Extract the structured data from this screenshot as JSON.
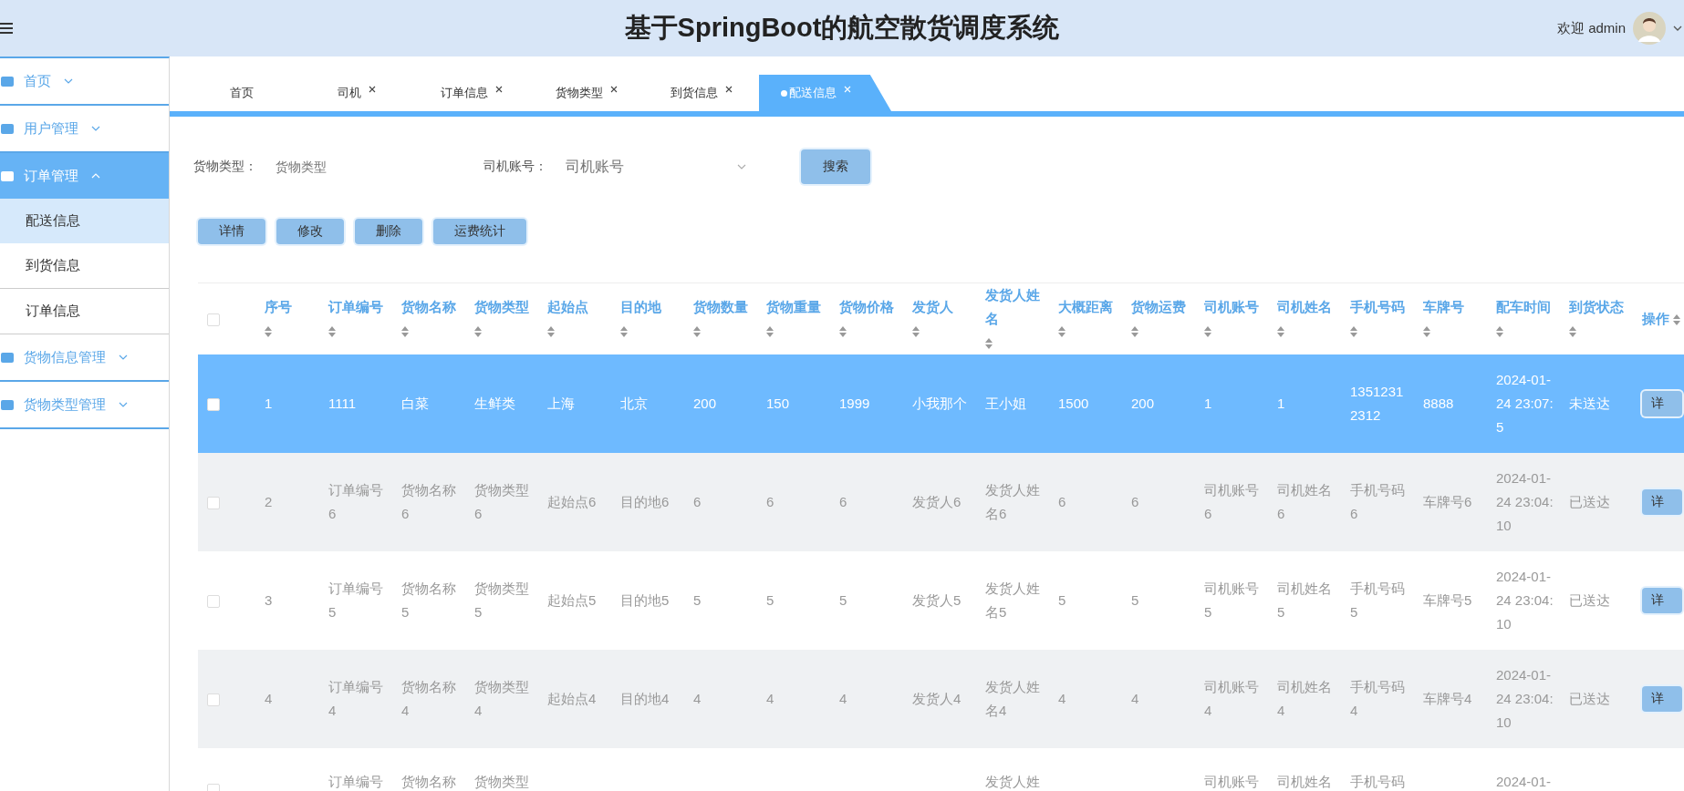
{
  "header": {
    "title": "基于SpringBoot的航空散货调度系统",
    "welcome": "欢迎 admin"
  },
  "sidebar": {
    "items": [
      {
        "label": "首页",
        "selected": false,
        "expanded": false
      },
      {
        "label": "用户管理",
        "selected": false,
        "expanded": false
      },
      {
        "label": "订单管理",
        "selected": true,
        "expanded": true,
        "children": [
          {
            "label": "配送信息",
            "selected": true
          },
          {
            "label": "到货信息",
            "selected": false
          },
          {
            "label": "订单信息",
            "selected": false
          }
        ]
      },
      {
        "label": "货物信息管理",
        "selected": false,
        "expanded": false
      },
      {
        "label": "货物类型管理",
        "selected": false,
        "expanded": false
      }
    ]
  },
  "tabs": [
    {
      "label": "首页",
      "closable": false,
      "selected": false
    },
    {
      "label": "司机",
      "closable": true,
      "selected": false
    },
    {
      "label": "订单信息",
      "closable": true,
      "selected": false
    },
    {
      "label": "货物类型",
      "closable": true,
      "selected": false
    },
    {
      "label": "到货信息",
      "closable": true,
      "selected": false
    },
    {
      "label": "配送信息",
      "closable": true,
      "selected": true
    }
  ],
  "search": {
    "fields": [
      {
        "kind": "input",
        "label": "货物类型：",
        "placeholder": "货物类型"
      },
      {
        "kind": "select",
        "label": "司机账号：",
        "placeholder": "司机账号"
      }
    ],
    "button": "搜索"
  },
  "actions": [
    "详情",
    "修改",
    "删除",
    "运费统计"
  ],
  "table": {
    "header_checked": false,
    "columns": [
      "序号",
      "订单编号",
      "货物名称",
      "货物类型",
      "起始点",
      "目的地",
      "货物数量",
      "货物重量",
      "货物价格",
      "发货人",
      "发货人姓名",
      "大概距离",
      "货物运费",
      "司机账号",
      "司机姓名",
      "手机号码",
      "车牌号",
      "配车时间",
      "到货状态",
      "操作"
    ],
    "rows": [
      {
        "checked": false,
        "selected": true,
        "cells": [
          "1",
          "1111",
          "白菜",
          "生鲜类",
          "上海",
          "北京",
          "200",
          "150",
          "1999",
          "小我那个",
          "王小姐",
          "1500",
          "200",
          "1",
          "1",
          "13512312312",
          "8888",
          "2024-01-24 23:07:5",
          "未送达"
        ],
        "action": "详"
      },
      {
        "checked": false,
        "selected": false,
        "cells": [
          "2",
          "订单编号6",
          "货物名称6",
          "货物类型6",
          "起始点6",
          "目的地6",
          "6",
          "6",
          "6",
          "发货人6",
          "发货人姓名6",
          "6",
          "6",
          "司机账号6",
          "司机姓名6",
          "手机号码6",
          "车牌号6",
          "2024-01-24 23:04:10",
          "已送达"
        ],
        "action": "详"
      },
      {
        "checked": false,
        "selected": false,
        "cells": [
          "3",
          "订单编号5",
          "货物名称5",
          "货物类型5",
          "起始点5",
          "目的地5",
          "5",
          "5",
          "5",
          "发货人5",
          "发货人姓名5",
          "5",
          "5",
          "司机账号5",
          "司机姓名5",
          "手机号码5",
          "车牌号5",
          "2024-01-24 23:04:10",
          "已送达"
        ],
        "action": "详"
      },
      {
        "checked": false,
        "selected": false,
        "cells": [
          "4",
          "订单编号4",
          "货物名称4",
          "货物类型4",
          "起始点4",
          "目的地4",
          "4",
          "4",
          "4",
          "发货人4",
          "发货人姓名4",
          "4",
          "4",
          "司机账号4",
          "司机姓名4",
          "手机号码4",
          "车牌号4",
          "2024-01-24 23:04:10",
          "已送达"
        ],
        "action": "详"
      },
      {
        "checked": false,
        "selected": false,
        "cells": [
          null,
          "订单编号",
          "货物名称",
          "货物类型",
          null,
          null,
          null,
          null,
          null,
          null,
          "发货人姓",
          null,
          null,
          "司机账号",
          "司机姓名",
          "手机号码",
          null,
          "2024-01-",
          null
        ]
      }
    ]
  }
}
